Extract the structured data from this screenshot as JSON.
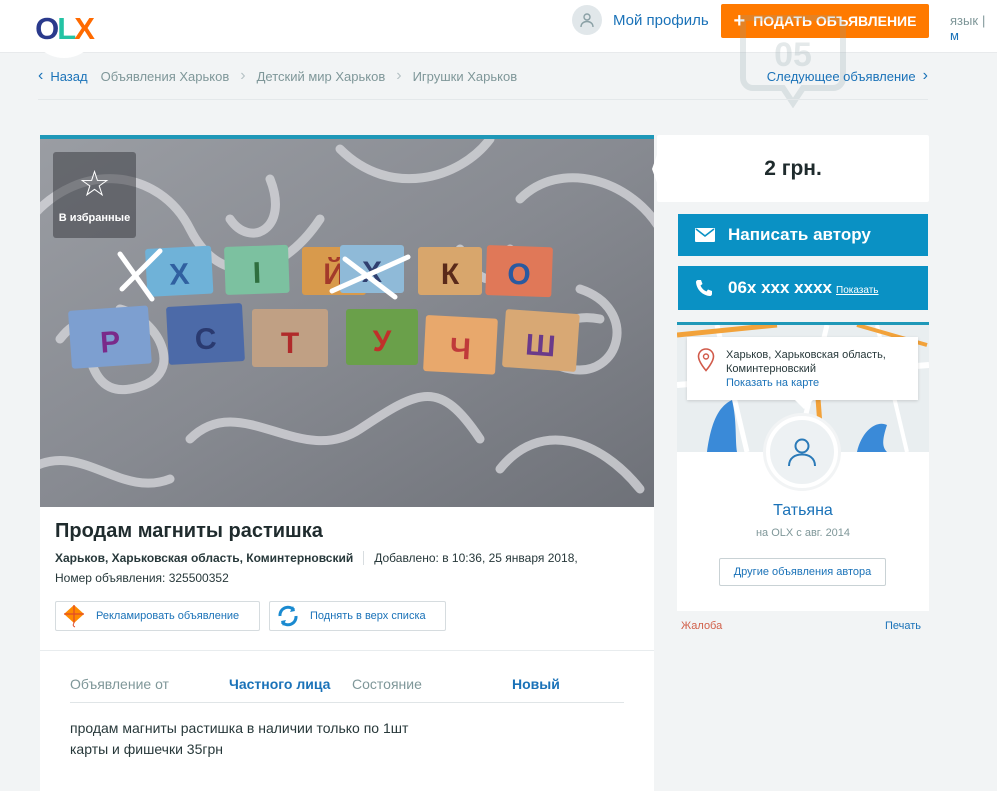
{
  "header": {
    "logo": "OLX",
    "profile_label": "Мой профиль",
    "post_ad_label": "ПОДАТЬ ОБЪЯВЛЕНИЕ",
    "lang_label": "язык",
    "lang_cut": "м"
  },
  "breadcrumbs": {
    "back_label": "Назад",
    "items": [
      "Объявления Харьков",
      "Детский мир Харьков",
      "Игрушки Харьков"
    ],
    "next_label": "Следующее объявление"
  },
  "gallery": {
    "favorite_label": "В избранные"
  },
  "ad": {
    "title": "Продам магниты растишка",
    "location": "Харьков, Харьковская область, Коминтерновский",
    "added": "Добавлено: в 10:36, 25 января 2018,",
    "ad_number": "Номер объявления: 325500352",
    "promote_label": "Рекламировать объявление",
    "raise_label": "Поднять в верх списка",
    "attributes": [
      {
        "label": "Объявление от",
        "value": "Частного лица"
      },
      {
        "label": "Состояние",
        "value": "Новый"
      }
    ],
    "description": "продам магниты растишка в наличии только по 1шт\nкарты и фишечки 35грн"
  },
  "sidebar": {
    "price": "2 грн.",
    "message_label": "Написать автору",
    "phone": "06x xxx xxxx",
    "phone_show_label": "Показать",
    "address_line1": "Харьков, Харьковская область,",
    "address_line2": "Коминтерновский",
    "show_map_label": "Показать на карте",
    "seller_name": "Татьяна",
    "seller_since": "на OLX с авг. 2014",
    "other_ads_label": "Другие объявления автора",
    "complain_label": "Жалоба",
    "print_label": "Печать"
  },
  "colors": {
    "accent_blue": "#0a91c4",
    "link_blue": "#1a72b8",
    "orange": "#ff7a00",
    "strip": "#1f98b8"
  },
  "photo_cards": {
    "row1": [
      "Х",
      "І",
      "Й",
      "Х",
      "К",
      "О"
    ],
    "row2": [
      "Р",
      "С",
      "Т",
      "У",
      "Ч",
      "Ш"
    ]
  }
}
